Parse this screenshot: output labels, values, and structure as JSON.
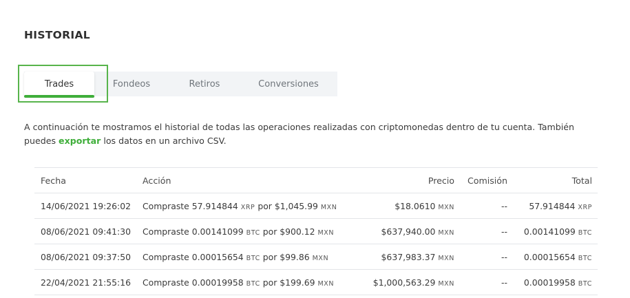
{
  "page": {
    "title": "HISTORIAL"
  },
  "tabs": [
    {
      "label": "Trades",
      "active": true
    },
    {
      "label": "Fondeos",
      "active": false
    },
    {
      "label": "Retiros",
      "active": false
    },
    {
      "label": "Conversiones",
      "active": false
    }
  ],
  "description": {
    "before": "A continuación te mostramos el historial de todas las operaciones realizadas con criptomonedas dentro de tu cuenta. También puedes ",
    "link": "exportar",
    "after": " los datos en un archivo CSV."
  },
  "colors": {
    "accent": "#3fae3a",
    "highlight_border": "#57b44b"
  },
  "table": {
    "headers": {
      "fecha": "Fecha",
      "accion": "Acción",
      "precio": "Precio",
      "comision": "Comisión",
      "total": "Total"
    },
    "rows": [
      {
        "fecha": "14/06/2021 19:26:02",
        "accion": {
          "prefix": "Compraste 57.914844",
          "unit1": "XRP",
          "middle": "por $1,045.99",
          "unit2": "MXN"
        },
        "precio": {
          "value": "$18.0610",
          "unit": "MXN"
        },
        "comision": "--",
        "total": {
          "value": "57.914844",
          "unit": "XRP"
        }
      },
      {
        "fecha": "08/06/2021 09:41:30",
        "accion": {
          "prefix": "Compraste 0.00141099",
          "unit1": "BTC",
          "middle": "por $900.12",
          "unit2": "MXN"
        },
        "precio": {
          "value": "$637,940.00",
          "unit": "MXN"
        },
        "comision": "--",
        "total": {
          "value": "0.00141099",
          "unit": "BTC"
        }
      },
      {
        "fecha": "08/06/2021 09:37:50",
        "accion": {
          "prefix": "Compraste 0.00015654",
          "unit1": "BTC",
          "middle": "por $99.86",
          "unit2": "MXN"
        },
        "precio": {
          "value": "$637,983.37",
          "unit": "MXN"
        },
        "comision": "--",
        "total": {
          "value": "0.00015654",
          "unit": "BTC"
        }
      },
      {
        "fecha": "22/04/2021 21:55:16",
        "accion": {
          "prefix": "Compraste 0.00019958",
          "unit1": "BTC",
          "middle": "por $199.69",
          "unit2": "MXN"
        },
        "precio": {
          "value": "$1,000,563.29",
          "unit": "MXN"
        },
        "comision": "--",
        "total": {
          "value": "0.00019958",
          "unit": "BTC"
        }
      }
    ]
  }
}
